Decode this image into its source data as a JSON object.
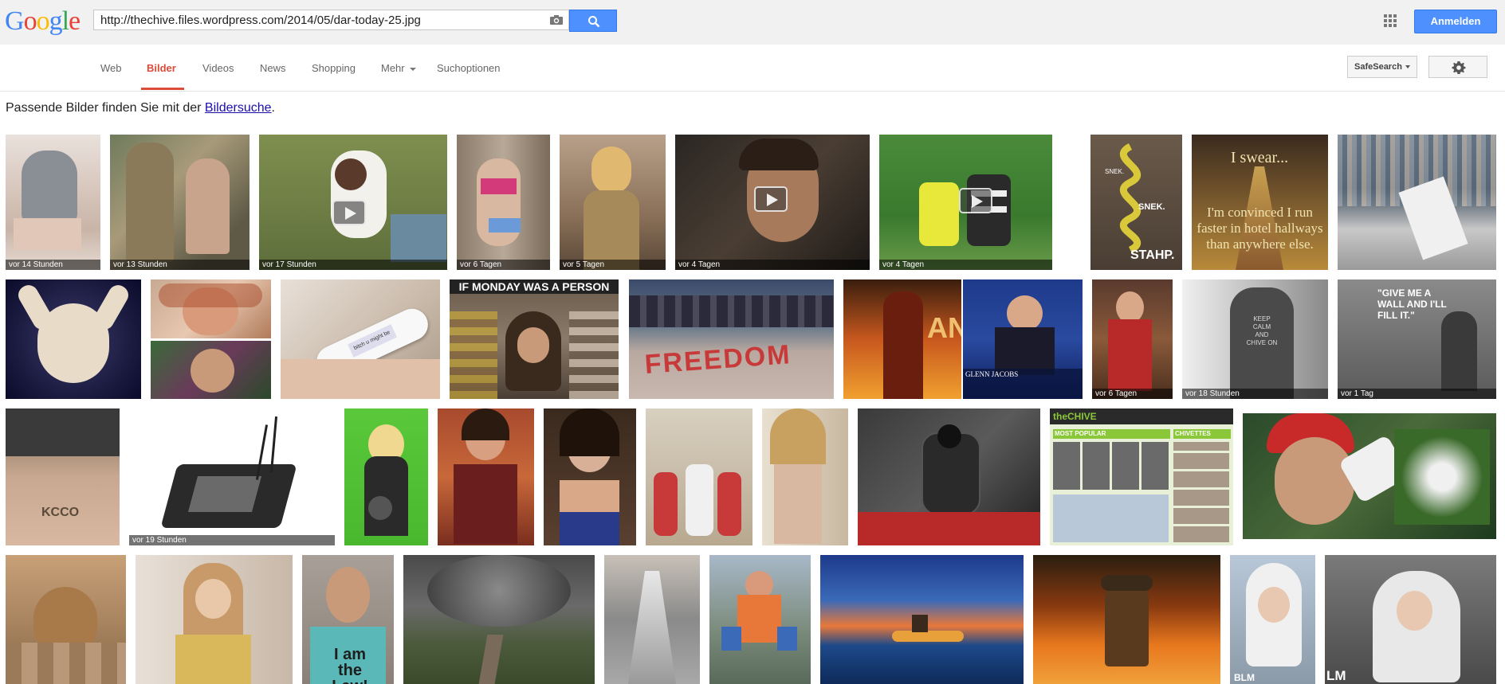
{
  "header": {
    "logo_text": "Google",
    "search_value": "http://thechive.files.wordpress.com/2014/05/dar-today-25.jpg",
    "signin_label": "Anmelden"
  },
  "nav": {
    "items": [
      "Web",
      "Bilder",
      "Videos",
      "News",
      "Shopping",
      "Mehr",
      "Suchoptionen"
    ],
    "active": "Bilder",
    "safesearch_label": "SafeSearch"
  },
  "hint": {
    "prefix": "Passende Bilder finden Sie mit der ",
    "link": "Bildersuche",
    "suffix": "."
  },
  "colors": {
    "accent": "#4d90fe",
    "active_tab": "#dd4b39",
    "link": "#1a0dab"
  },
  "thumbnails": {
    "labels": {
      "r1_1": "vor 14 Stunden",
      "r1_2": "vor 13 Stunden",
      "r1_3": "vor 17 Stunden",
      "r1_4": "vor 6 Tagen",
      "r1_5": "vor 5 Tagen",
      "r1_6": "vor 4 Tagen",
      "r1_7": "vor 4 Tagen",
      "r2_10": "vor 6 Tagen",
      "r2_11": "vor 18 Stunden",
      "r2_12": "vor 1 Tag",
      "r3_2": "vor 19 Stunden"
    },
    "overlay_text": {
      "snek": "SNEK.",
      "stahp": "STAHP.",
      "swear_top": "I swear...",
      "swear_bottom": "I'm convinced I run faster in hotel hallways than anywhere else.",
      "monday": "IF MONDAY WAS A PERSON",
      "pregnancy": "bitch u might be",
      "freedom": "FREEDOM",
      "glenn": "GLENN JACOBS",
      "give_me": "\"GIVE ME A WALL AND I'LL FILL IT.\"",
      "keep_calm": "KEEP CALM AND CHIVE ON",
      "kcco": "KCCO",
      "i_am_law": "I am the Law!",
      "chive_logo": "theCHIVE",
      "most_popular": "MOST POPULAR",
      "chivettes": "CHIVETTES",
      "blm1": "BLM",
      "blm2": "LM"
    }
  }
}
